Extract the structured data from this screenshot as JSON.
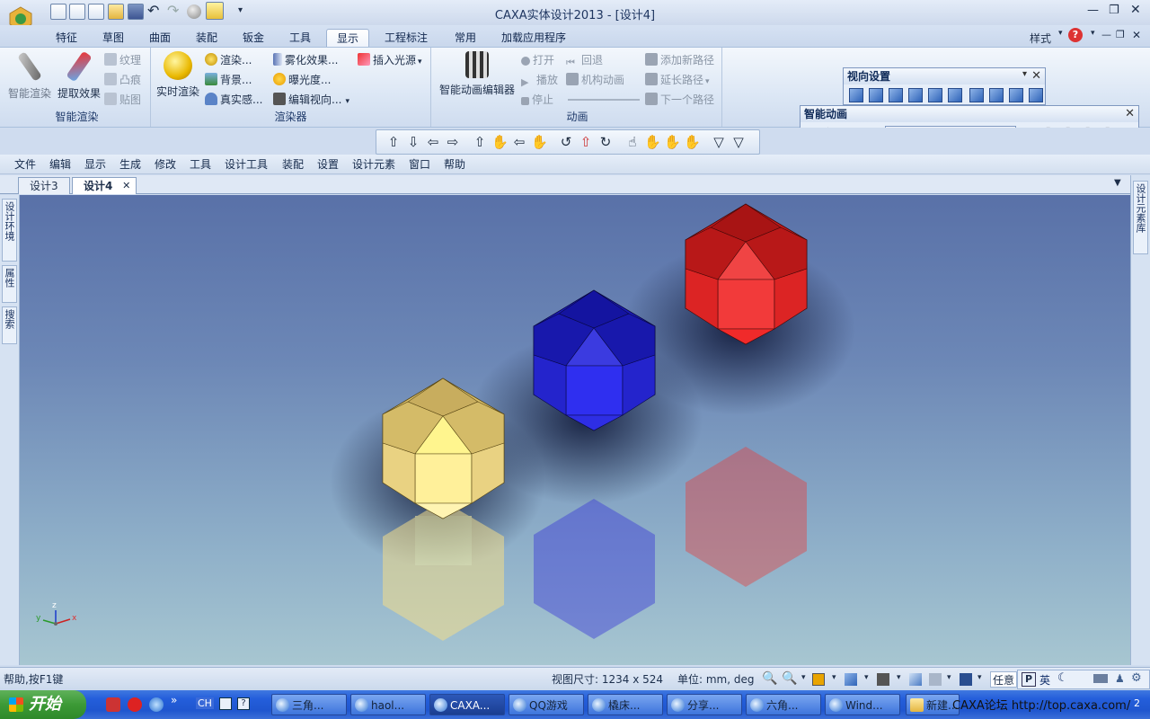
{
  "app": {
    "title": "CAXA实体设计2013 - [设计4]"
  },
  "window_controls": {
    "style_label": "样式",
    "help_icon": "?"
  },
  "ribbon_tabs": [
    "特征",
    "草图",
    "曲面",
    "装配",
    "钣金",
    "工具",
    "显示",
    "工程标注",
    "常用",
    "加载应用程序"
  ],
  "active_tab": "显示",
  "ribbon": {
    "smart_render": {
      "group_label": "智能渲染",
      "smart_render_btn": "智能渲染",
      "extract_btn": "提取效果",
      "texture": "纹理",
      "bump": "凸痕",
      "decal": "贴图"
    },
    "renderer": {
      "group_label": "渲染器",
      "realtime_btn": "实时渲染",
      "render": "渲染...",
      "background": "背景...",
      "realistic": "真实感...",
      "fog": "雾化效果...",
      "exposure": "曝光度...",
      "edit_view": "编辑视向...",
      "insert_light": "插入光源"
    },
    "animation": {
      "group_label": "动画",
      "editor_btn": "智能动画编辑器",
      "open": "打开",
      "play": "播放",
      "stop": "停止",
      "rewind": "回退",
      "mechanism": "机构动画",
      "add_path": "添加新路径",
      "extend_path": "延长路径",
      "next_path": "下一个路径"
    }
  },
  "view_panel": {
    "title": "视向设置"
  },
  "anim_panel": {
    "title": "智能动画"
  },
  "nav_toolbar": {
    "buttons": [
      "⇧",
      "⇩",
      "⇦",
      "⇨",
      "⇧",
      "✋",
      "⇦",
      "✋",
      "↺",
      "⇧",
      "↻",
      "☝",
      "✋",
      "✋",
      "✋",
      "▽",
      "▽"
    ]
  },
  "menu": [
    "文件",
    "编辑",
    "显示",
    "生成",
    "修改",
    "工具",
    "设计工具",
    "装配",
    "设置",
    "设计元素",
    "窗口",
    "帮助"
  ],
  "doc_tabs": [
    "设计3",
    "设计4"
  ],
  "active_doc": "设计4",
  "left_sidebar": [
    "设计环境",
    "属性",
    "搜索"
  ],
  "right_sidebar": [
    "设计元素库"
  ],
  "axis": {
    "z": "z",
    "y": "y",
    "x": "x"
  },
  "status": {
    "help": "帮助,按F1键",
    "view_size": "视图尺寸: 1234 x 524",
    "units": "单位: mm, deg",
    "mode": "任意"
  },
  "ime": {
    "lang": "英",
    "p": "P"
  },
  "taskbar": {
    "start": "开始",
    "quick": [
      "CH"
    ],
    "items": [
      "三角...",
      "haol...",
      "CAXA...",
      "QQ游戏",
      "橇床...",
      "分享...",
      "六角...",
      "Wind...",
      "新建..."
    ],
    "watermark": "CAXA论坛 http://top.caxa.com/",
    "clock": "2"
  },
  "colors": {
    "yellow": "#f2dc8a",
    "blue": "#1f1fc8",
    "red": "#d81f1f",
    "viewport_top": "#5971a8",
    "viewport_bottom": "#a7c6d1"
  }
}
